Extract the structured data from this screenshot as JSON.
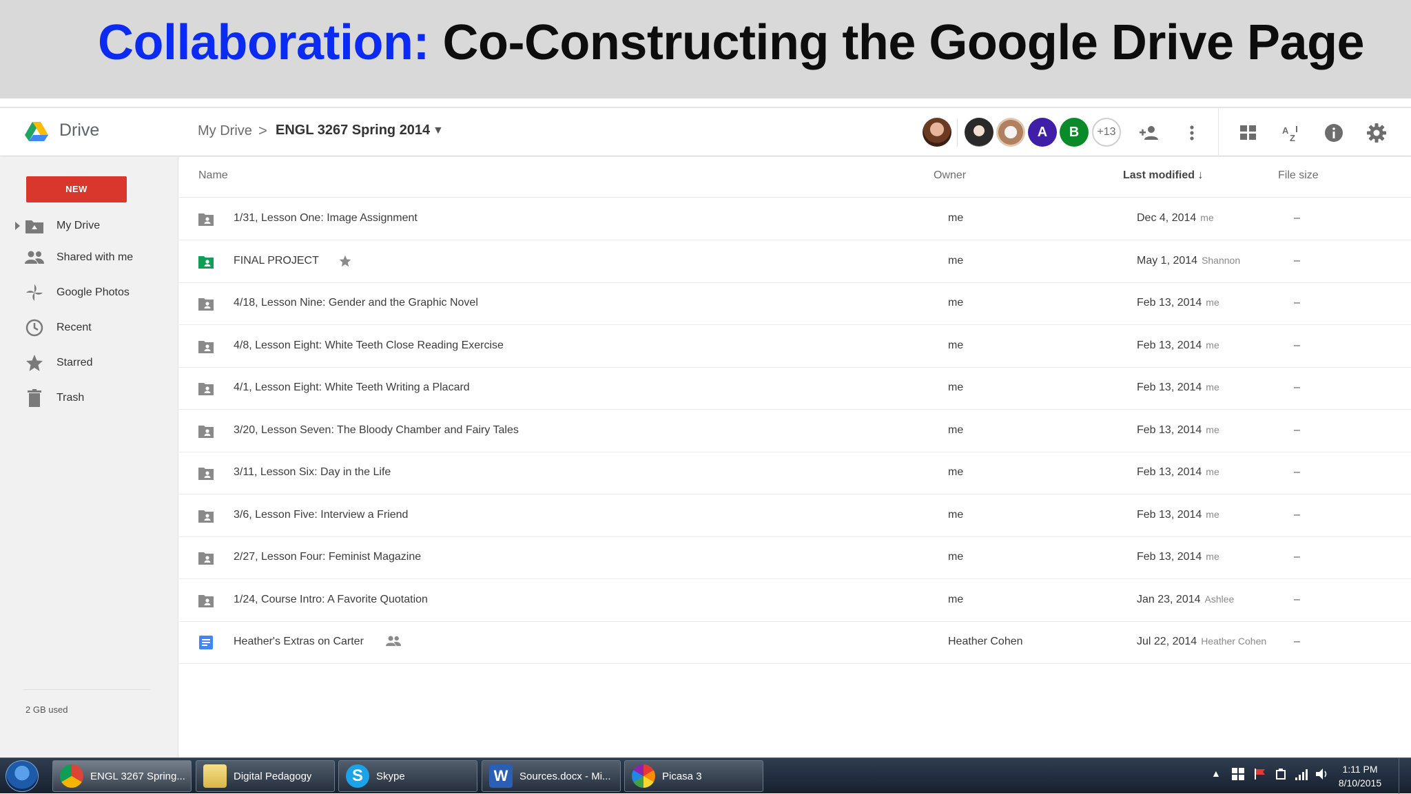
{
  "slide": {
    "title_accent": "Collaboration:",
    "title_rest": "Co-Constructing the Google Drive Page"
  },
  "header": {
    "app_name": "Drive",
    "breadcrumb_root": "My Drive",
    "breadcrumb_sep": ">",
    "breadcrumb_current": "ENGL 3267 Spring 2014",
    "collaborators": [
      {
        "letter": "A",
        "color": "#3f1ea8"
      },
      {
        "letter": "B",
        "color": "#0b8a2a"
      }
    ],
    "more_collaborators": "+13"
  },
  "sidebar": {
    "new_label": "NEW",
    "items": [
      {
        "label": "My Drive",
        "icon": "drive-folder-icon"
      },
      {
        "label": "Shared with me",
        "icon": "people-icon"
      },
      {
        "label": "Google Photos",
        "icon": "pinwheel-icon"
      },
      {
        "label": "Recent",
        "icon": "clock-icon"
      },
      {
        "label": "Starred",
        "icon": "star-icon"
      },
      {
        "label": "Trash",
        "icon": "trash-icon"
      }
    ],
    "storage": "2 GB used"
  },
  "columns": {
    "name": "Name",
    "owner": "Owner",
    "modified": "Last modified ↓",
    "size": "File size"
  },
  "rows": [
    {
      "name": "1/31, Lesson One: Image Assignment",
      "owner": "me",
      "date": "Dec 4, 2014",
      "by": "me",
      "size": "–",
      "type": "shared-folder"
    },
    {
      "name": "FINAL PROJECT",
      "owner": "me",
      "date": "May 1, 2014",
      "by": "Shannon",
      "size": "–",
      "type": "green-folder",
      "starred": true
    },
    {
      "name": "4/18, Lesson Nine: Gender and the Graphic Novel",
      "owner": "me",
      "date": "Feb 13, 2014",
      "by": "me",
      "size": "–",
      "type": "shared-folder"
    },
    {
      "name": "4/8, Lesson Eight: White Teeth Close Reading Exercise",
      "owner": "me",
      "date": "Feb 13, 2014",
      "by": "me",
      "size": "–",
      "type": "shared-folder"
    },
    {
      "name": "4/1, Lesson Eight: White Teeth Writing a Placard",
      "owner": "me",
      "date": "Feb 13, 2014",
      "by": "me",
      "size": "–",
      "type": "shared-folder"
    },
    {
      "name": "3/20, Lesson Seven: The Bloody Chamber and Fairy Tales",
      "owner": "me",
      "date": "Feb 13, 2014",
      "by": "me",
      "size": "–",
      "type": "shared-folder"
    },
    {
      "name": "3/11, Lesson Six: Day in the Life",
      "owner": "me",
      "date": "Feb 13, 2014",
      "by": "me",
      "size": "–",
      "type": "shared-folder"
    },
    {
      "name": "3/6, Lesson Five: Interview a Friend",
      "owner": "me",
      "date": "Feb 13, 2014",
      "by": "me",
      "size": "–",
      "type": "shared-folder"
    },
    {
      "name": "2/27, Lesson Four: Feminist Magazine",
      "owner": "me",
      "date": "Feb 13, 2014",
      "by": "me",
      "size": "–",
      "type": "shared-folder"
    },
    {
      "name": "1/24, Course Intro: A Favorite Quotation",
      "owner": "me",
      "date": "Jan 23, 2014",
      "by": "Ashlee",
      "size": "–",
      "type": "shared-folder"
    },
    {
      "name": "Heather's Extras on Carter",
      "owner": "Heather Cohen",
      "date": "Jul 22, 2014",
      "by": "Heather Cohen",
      "size": "–",
      "type": "doc",
      "shared": true
    }
  ],
  "taskbar": {
    "tasks": [
      {
        "label": "ENGL 3267 Spring...",
        "icon": "chrome-icon"
      },
      {
        "label": "Digital Pedagogy",
        "icon": "folder-icon"
      },
      {
        "label": "Skype",
        "icon": "skype-icon"
      },
      {
        "label": "Sources.docx - Mi...",
        "icon": "word-icon"
      },
      {
        "label": "Picasa 3",
        "icon": "picasa-icon"
      }
    ],
    "time": "1:11 PM",
    "date": "8/10/2015"
  }
}
